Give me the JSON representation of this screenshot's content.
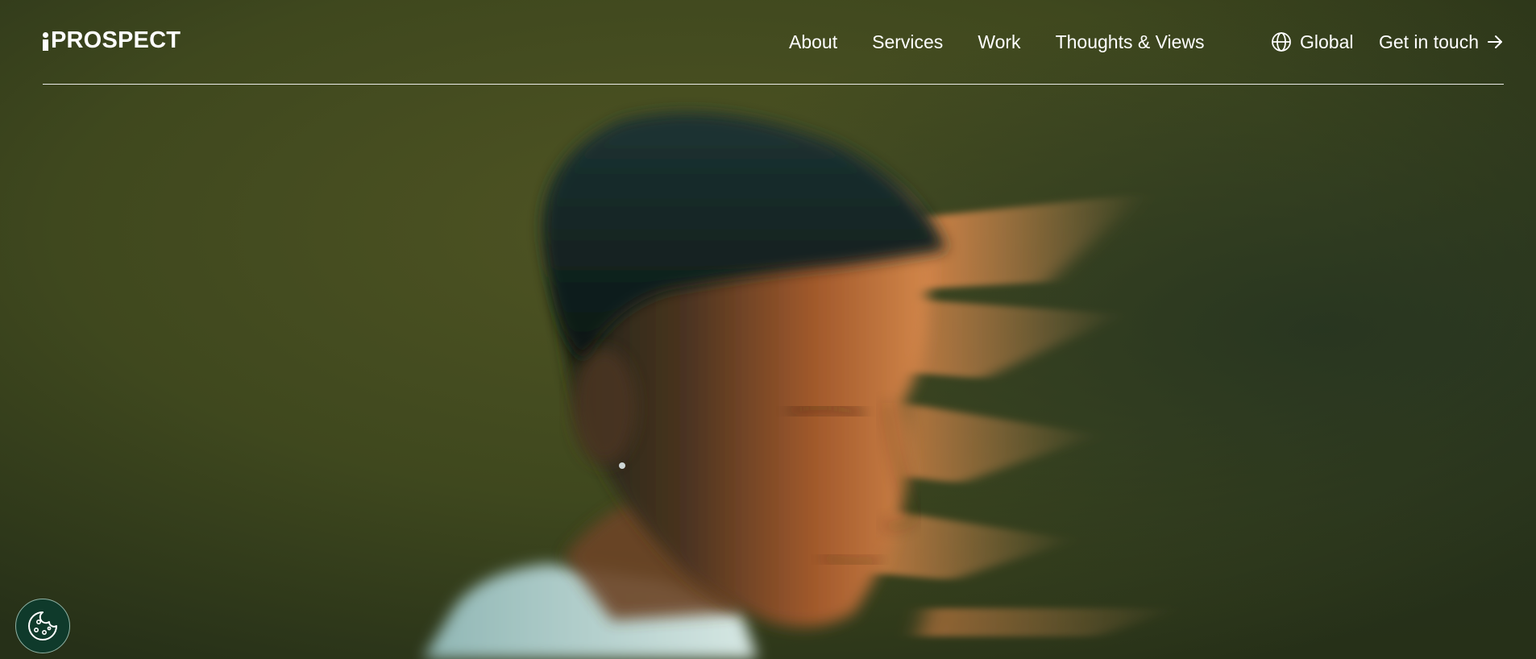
{
  "colors": {
    "background": "#35411c",
    "text": "#ffffff",
    "cookie_button": "#0f3a2b"
  },
  "header": {
    "logo_text": "PROSPECT",
    "nav_items": [
      {
        "label": "About"
      },
      {
        "label": "Services"
      },
      {
        "label": "Work"
      },
      {
        "label": "Thoughts & Views"
      }
    ],
    "region_label": "Global",
    "region_icon": "globe-icon",
    "cta_label": "Get in touch",
    "cta_icon": "arrow-right-icon"
  },
  "hero": {
    "image_icon": "profile-portrait-photo"
  },
  "cookie": {
    "icon": "cookie-icon"
  }
}
